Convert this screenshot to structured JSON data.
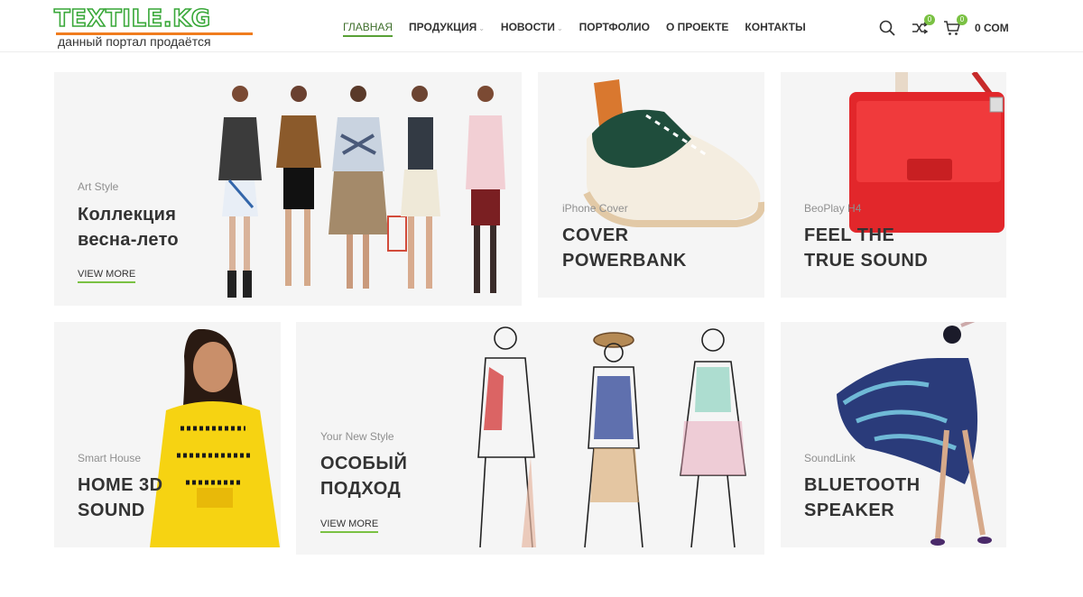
{
  "header": {
    "logo_title": "TEXTILE.KG",
    "logo_subtitle": "данный портал продаётся",
    "nav": [
      {
        "label": "ГЛАВНАЯ",
        "active": true
      },
      {
        "label": "ПРОДУКЦИЯ",
        "caret": true
      },
      {
        "label": "НОВОСТИ",
        "caret": true
      },
      {
        "label": "ПОРТФОЛИО"
      },
      {
        "label": "О ПРОЕКТЕ"
      },
      {
        "label": "КОНТАКТЫ"
      }
    ],
    "compare_count": "0",
    "cart_count": "0",
    "cart_total": "0 СОМ",
    "icons": [
      "search-icon",
      "compare-icon",
      "cart-icon"
    ]
  },
  "banners": {
    "b1": {
      "subtitle": "Art Style",
      "title_line1": "Коллекция",
      "title_line2": "весна-лето",
      "link": "VIEW MORE"
    },
    "b2": {
      "subtitle": "iPhone Cover",
      "title_line1": "COVER",
      "title_line2": "POWERBANK"
    },
    "b3": {
      "subtitle": "BeoPlay H4",
      "title_line1": "FEEL THE",
      "title_line2": "TRUE SOUND"
    },
    "b4": {
      "subtitle": "Smart House",
      "title_line1": "HOME 3D",
      "title_line2": "SOUND"
    },
    "b5": {
      "subtitle": "Your New Style",
      "title_line1": "ОСОБЫЙ",
      "title_line2": "ПОДХОД",
      "link": "VIEW MORE"
    },
    "b6": {
      "subtitle": "SoundLink",
      "title_line1": "BLUETOOTH",
      "title_line2": "SPEAKER"
    }
  },
  "colors": {
    "accent": "#7ac143",
    "banner_bg": "#f5f5f5",
    "logo_green": "#3aa83a",
    "logo_orange": "#f07c1e"
  }
}
